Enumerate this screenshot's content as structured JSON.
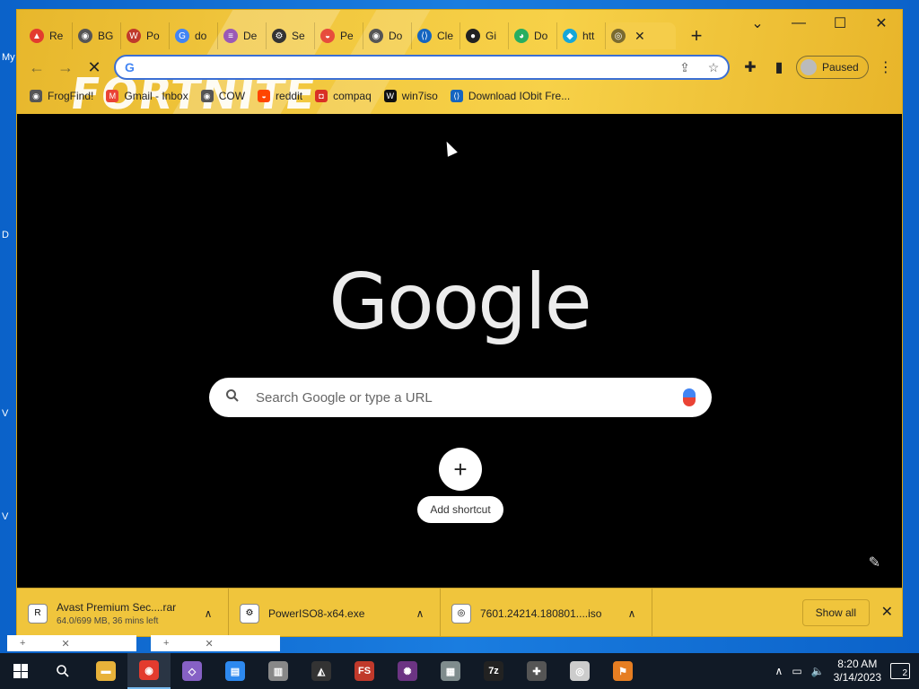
{
  "desktop": {
    "labels": [
      "My",
      "D",
      "V",
      "V"
    ]
  },
  "tabs": [
    {
      "label": "Re",
      "color": "#e33b2e",
      "glyph": "▲"
    },
    {
      "label": "BG",
      "color": "#555555",
      "glyph": "◉"
    },
    {
      "label": "Po",
      "color": "#c0392b",
      "glyph": "W"
    },
    {
      "label": "do",
      "color": "#4285f4",
      "glyph": "G"
    },
    {
      "label": "De",
      "color": "#9b59b6",
      "glyph": "≡"
    },
    {
      "label": "Se",
      "color": "#333333",
      "glyph": "⚙"
    },
    {
      "label": "Pe",
      "color": "#e74c3c",
      "glyph": "◒"
    },
    {
      "label": "Do",
      "color": "#555555",
      "glyph": "◉"
    },
    {
      "label": "Cle",
      "color": "#1565c0",
      "glyph": "⟨⟩"
    },
    {
      "label": "Gi",
      "color": "#222222",
      "glyph": "●"
    },
    {
      "label": "Do",
      "color": "#27ae60",
      "glyph": "◕"
    },
    {
      "label": "htt",
      "color": "#16a7d9",
      "glyph": "◆"
    }
  ],
  "active_tab": {
    "glyph": "◎"
  },
  "window_controls": {
    "dropdown": "⌄",
    "minimize": "—",
    "maximize": "☐",
    "close": "✕"
  },
  "toolbar": {
    "back": "←",
    "forward": "→",
    "stop": "✕",
    "omnibox_g": "G",
    "omnibox_value": "",
    "share": "⇪",
    "star": "☆",
    "extensions": "✚",
    "sidepanel": "▮",
    "profile_label": "Paused",
    "menu": "⋮"
  },
  "bookmarks": [
    {
      "label": "FrogFind!",
      "color": "#555555",
      "glyph": "◉"
    },
    {
      "label": "Gmail - Inbox",
      "color": "#ea4335",
      "glyph": "M"
    },
    {
      "label": "COW",
      "color": "#555555",
      "glyph": "◉"
    },
    {
      "label": "reddit",
      "color": "#ff4500",
      "glyph": "◒"
    },
    {
      "label": "compaq",
      "color": "#d93025",
      "glyph": "◘"
    },
    {
      "label": "win7iso",
      "color": "#111111",
      "glyph": "W"
    },
    {
      "label": "Download IObit Fre...",
      "color": "#1565c0",
      "glyph": "⟨⟩"
    }
  ],
  "theme_text": "FORTNITE",
  "ntp": {
    "logo": "Google",
    "search_placeholder": "Search Google or type a URL",
    "add_shortcut": "Add shortcut",
    "plus": "+",
    "edit": "✎"
  },
  "downloads": [
    {
      "name": "Avast Premium Sec....rar",
      "status": "64.0/699 MB, 36 mins left",
      "glyph": "R"
    },
    {
      "name": "PowerISO8-x64.exe",
      "status": "",
      "glyph": "⚙"
    },
    {
      "name": "7601.24214.180801....iso",
      "status": "",
      "glyph": "◎"
    }
  ],
  "shelf": {
    "show_all": "Show all",
    "close": "✕"
  },
  "taskbar": {
    "apps": [
      {
        "name": "file-explorer",
        "glyph": "▬",
        "color": "#e8b23a"
      },
      {
        "name": "chrome",
        "glyph": "◉",
        "color": "#e33b2e",
        "active": true
      },
      {
        "name": "visual-studio",
        "glyph": "◇",
        "color": "#8661c5"
      },
      {
        "name": "control-panel",
        "glyph": "▤",
        "color": "#2d89ef"
      },
      {
        "name": "printer",
        "glyph": "▥",
        "color": "#888888"
      },
      {
        "name": "vegas",
        "glyph": "◭",
        "color": "#333333"
      },
      {
        "name": "fs",
        "glyph": "FS",
        "color": "#c0392b"
      },
      {
        "name": "game",
        "glyph": "✺",
        "color": "#6c3483"
      },
      {
        "name": "network",
        "glyph": "▦",
        "color": "#7f8c8d"
      },
      {
        "name": "7zip",
        "glyph": "7z",
        "color": "#222222"
      },
      {
        "name": "steam",
        "glyph": "✚",
        "color": "#555555"
      },
      {
        "name": "disc",
        "glyph": "◎",
        "color": "#cccccc"
      },
      {
        "name": "windows-flag",
        "glyph": "⚑",
        "color": "#e67e22"
      }
    ],
    "tray": {
      "chevron": "∧",
      "network": "▭",
      "volume": "🔈",
      "time": "8:20 AM",
      "date": "3/14/2023",
      "notifications": "2"
    }
  }
}
